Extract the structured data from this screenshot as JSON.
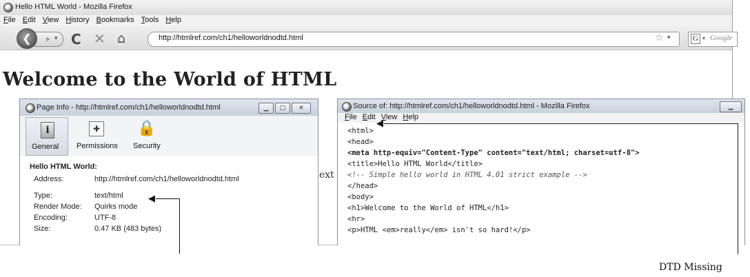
{
  "browser": {
    "window_title": "Hello HTML World - Mozilla Firefox",
    "menu": [
      "File",
      "Edit",
      "View",
      "History",
      "Bookmarks",
      "Tools",
      "Help"
    ],
    "url": "http://htmlref.com/ch1/helloworldnodtd.html",
    "search_placeholder": "Google",
    "search_engine_letter": "G"
  },
  "page": {
    "heading": "Welcome to the World of HTML",
    "fragment_text": "ext"
  },
  "page_info": {
    "window_title": "Page Info - http://htmlref.com/ch1/helloworldnodtd.html",
    "tabs": [
      "General",
      "Permissions",
      "Security"
    ],
    "doc_title": "Hello HTML World:",
    "rows": [
      {
        "label": "Address:",
        "value": "http://htmlref.com/ch1/helloworldnodtd.html"
      },
      {
        "label": "Type:",
        "value": "text/html"
      },
      {
        "label": "Render Mode:",
        "value": "Quirks mode"
      },
      {
        "label": "Encoding:",
        "value": "UTF-8"
      },
      {
        "label": "Size:",
        "value": "0.47 KB (483 bytes)"
      }
    ]
  },
  "source": {
    "window_title": "Source of: http://htmlref.com/ch1/helloworldnodtd.html - Mozilla Firefox",
    "menu": [
      "File",
      "Edit",
      "View",
      "Help"
    ],
    "lines": [
      "<html>",
      "<head>",
      "<meta http-equiv=\"Content-Type\" content=\"text/html; charset=utf-8\">",
      "<title>Hello HTML World</title>",
      "<!-- Simple hello world in HTML 4.01 strict example -->",
      "</head>",
      "<body>",
      "<h1>Welcome to the World of HTML</h1>",
      "<hr>",
      "<p>HTML <em>really</em> isn't so hard!</p>"
    ]
  },
  "annotation": {
    "label": "DTD Missing"
  }
}
